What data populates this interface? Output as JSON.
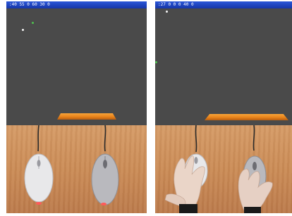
{
  "panels": [
    {
      "status_text": ":40 55 0 60 30 0",
      "targets": [
        {
          "color": "#4ec24e"
        },
        {
          "color": "#f4f4f4"
        }
      ],
      "mice": [
        {
          "color": "#e8e8ea",
          "light_color": "#ff5a5a"
        },
        {
          "color": "#b9b9be",
          "light_color": "#ff5a5a"
        }
      ]
    },
    {
      "status_text": ":27 0 0 0 40 0",
      "targets": [
        {
          "color": "#f4f4f4"
        },
        {
          "color": "#4ec24e"
        }
      ],
      "mice": [
        {
          "color": "#e8e8ea",
          "light_color": "#ff5a5a"
        },
        {
          "color": "#b9b9be",
          "light_color": "#ff5a5a"
        }
      ]
    }
  ],
  "colors": {
    "game_background": "#4a4a4a",
    "paddle": "#f08a1f",
    "desk": "#c98a55",
    "titlebar": "#1e46c0"
  },
  "icons": [
    "target-dot-icon",
    "paddle-icon",
    "mouse-icon",
    "hand-icon"
  ]
}
